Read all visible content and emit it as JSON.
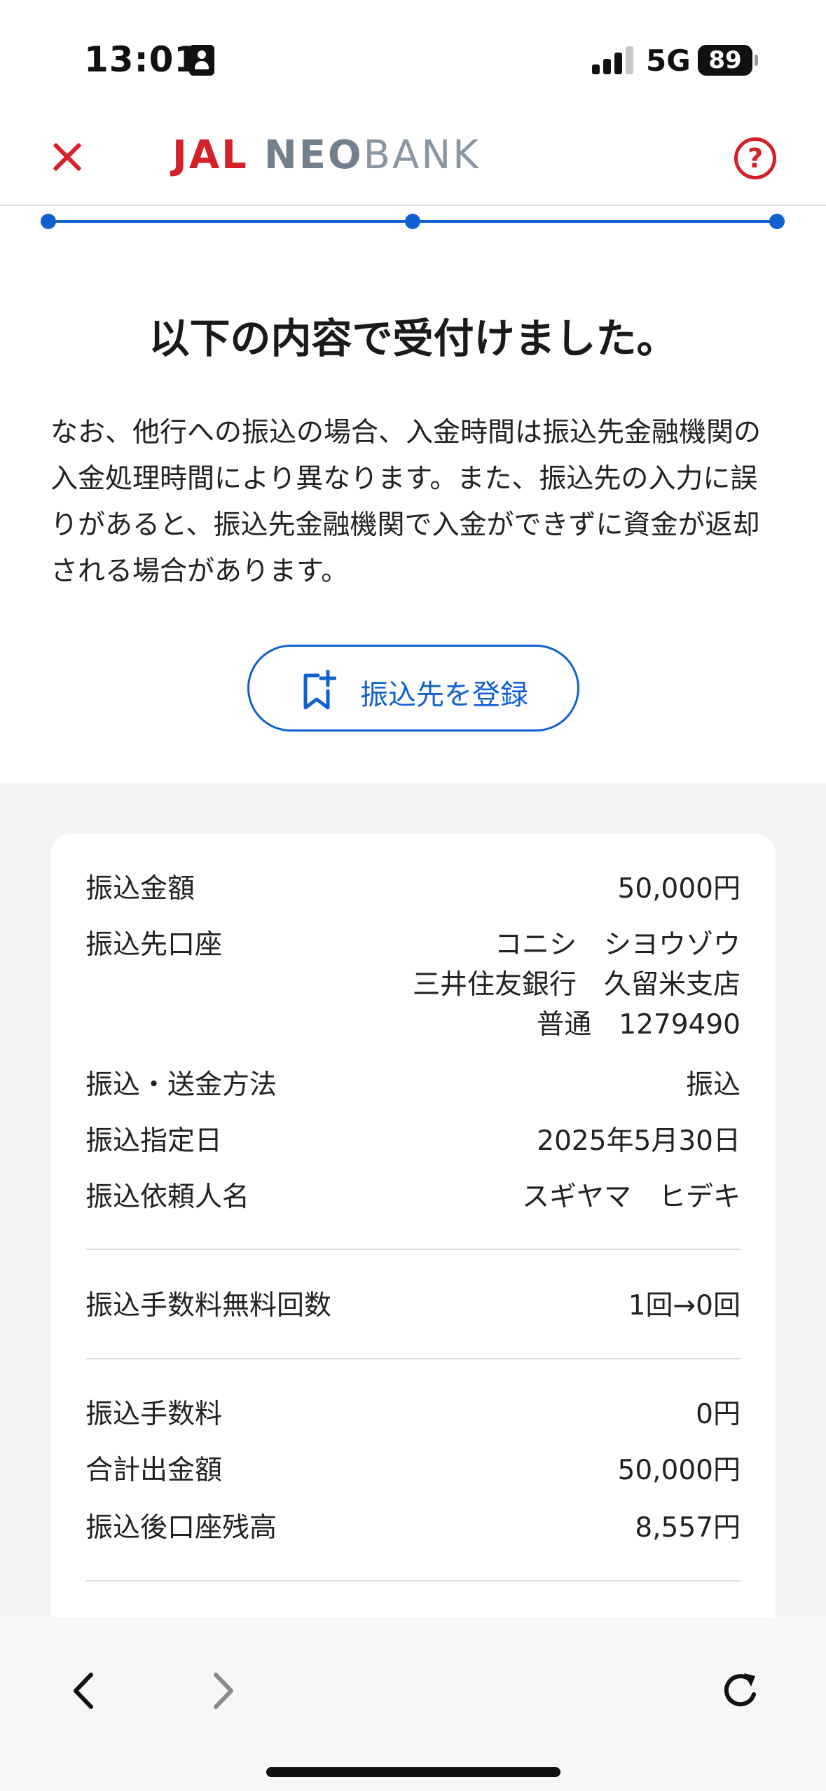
{
  "status_bar": {
    "time": "13:01",
    "network": "5G",
    "battery": "89",
    "icons": [
      "person-badge-icon",
      "signal-bars-icon",
      "battery-icon"
    ]
  },
  "header": {
    "logo": {
      "jal": "JAL",
      "neo": "NEO",
      "bank": "BANK"
    },
    "close_icon": "close-icon",
    "help_symbol": "?",
    "brand_red": "#d42027"
  },
  "progress": {
    "total_steps": 3,
    "completed_steps": 3,
    "color": "#1160d2"
  },
  "main": {
    "title": "以下の内容で受付けました。",
    "notice": "なお、他行への振込の場合、入金時間は振込先金融機関の入金処理時間により異なります。また、振込先の入力に誤りがあると、振込先金融機関で入金ができずに資金が返却される場合があります。",
    "register_button": {
      "label": "振込先を登録",
      "icon": "bookmark-add-icon"
    }
  },
  "details": {
    "amount": {
      "label": "振込金額",
      "value": "50,000円"
    },
    "account": {
      "label": "振込先口座",
      "name": "コニシ　シヨウゾウ",
      "bank": "三井住友銀行　久留米支店",
      "number": "普通　1279490"
    },
    "method": {
      "label": "振込・送金方法",
      "value": "振込"
    },
    "date": {
      "label": "振込指定日",
      "value": "2025年5月30日"
    },
    "requester": {
      "label": "振込依頼人名",
      "value": "スギヤマ　ヒデキ"
    },
    "free_count": {
      "label": "振込手数料無料回数",
      "value": "1回→0回"
    },
    "fee": {
      "label": "振込手数料",
      "value": "0円"
    },
    "total": {
      "label": "合計出金額",
      "value": "50,000円"
    },
    "balance": {
      "label": "振込後口座残高",
      "value": "8,557円"
    }
  },
  "bottom_bar": {
    "icons": [
      "back-arrow-icon",
      "forward-arrow-icon",
      "reload-icon"
    ]
  }
}
